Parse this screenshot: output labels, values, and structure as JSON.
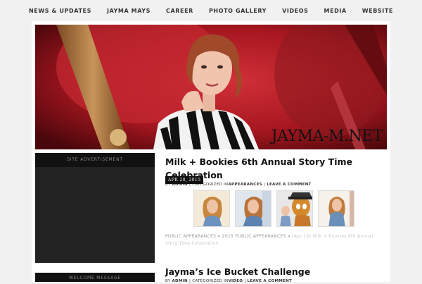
{
  "nav": {
    "items": [
      "NEWS & UPDATES",
      "JAYMA MAYS",
      "CAREER",
      "PHOTO GALLERY",
      "VIDEOS",
      "MEDIA",
      "WEBSITE"
    ]
  },
  "banner": {
    "site_name": "JAYMA-M.NET"
  },
  "sidebar": {
    "advert_header": "SITE ADVERTISEMENT",
    "welcome_header": "WELCOME MESSAGE"
  },
  "posts": [
    {
      "title": "Milk + Bookies 6th Annual Story Time Celebration",
      "meta_by": "BY",
      "author": "ADMIN",
      "meta_cat": "CATEGORIZED IN",
      "category": "APPEARANCES",
      "comment_link": "LEAVE A COMMENT",
      "date": "APR 20, 2015",
      "breadcrumb": {
        "crumb1": "PUBLIC APPEARANCES",
        "crumb2": "2015 PUBLIC APPEARANCES",
        "current": "[Apr 19] Milk + Bookies 6th Annual Story Time Celebration",
        "separator": "»"
      }
    },
    {
      "title": "Jayma’s Ice Bucket Challenge",
      "meta_by": "BY",
      "author": "ADMIN",
      "meta_cat": "CATEGORIZED IN",
      "category": "VIDEO",
      "comment_link": "LEAVE A COMMENT"
    }
  ],
  "colors": {
    "banner_red": "#b3202a",
    "sidebar_dark": "#222222",
    "sidebar_header": "#111111"
  }
}
